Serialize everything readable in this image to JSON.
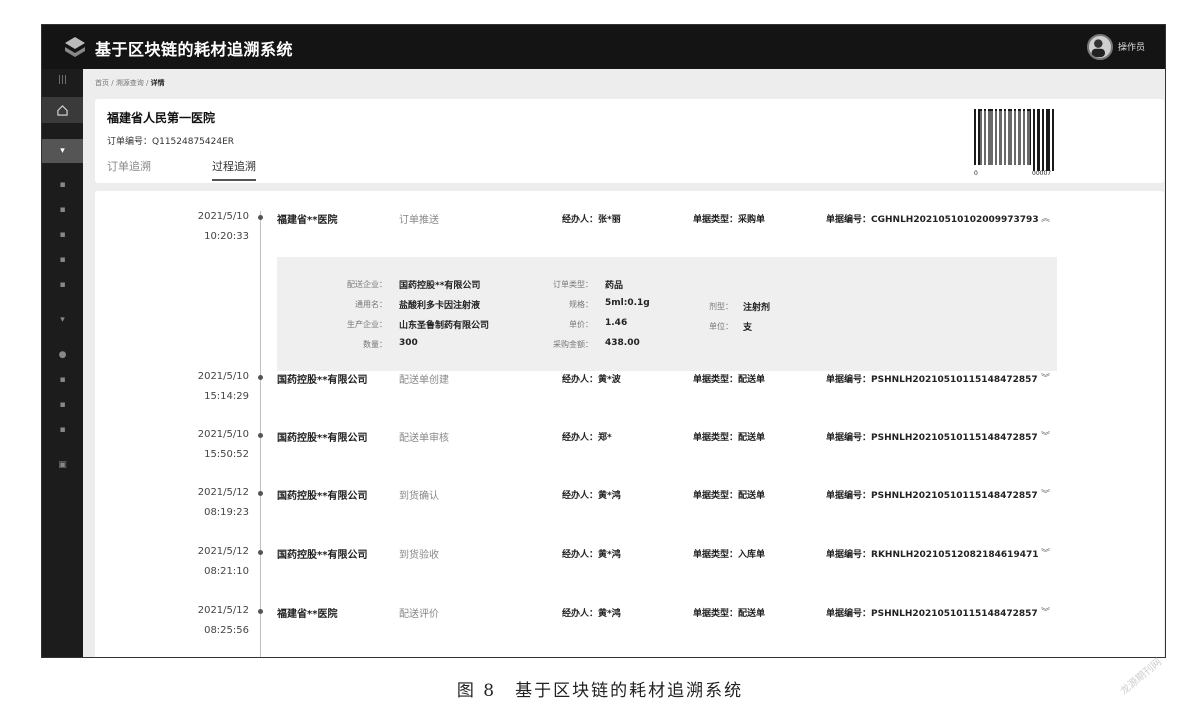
{
  "app": {
    "title": "基于区块链的耗材追溯系统",
    "user_name": "操作员"
  },
  "breadcrumb": {
    "home": "首页",
    "sep1": " / ",
    "query": "溯源查询",
    "sep2": " / ",
    "current": "详情"
  },
  "order": {
    "hospital": "福建省人民第一医院",
    "order_label": "订单编号：",
    "order_no": "Q11524875424ER",
    "barcode_left": "0",
    "barcode_right": "00007"
  },
  "tabs": [
    {
      "label": "订单追溯"
    },
    {
      "label": "过程追溯"
    }
  ],
  "labels": {
    "handler": "经办人：",
    "doc_type": "单据类型：",
    "doc_no": "单据编号："
  },
  "records": [
    {
      "date": "2021/5/10",
      "time": "10:20:33",
      "org": "福建省**医院",
      "action": "订单推送",
      "handler": "张*丽",
      "doc_type": "采购单",
      "doc_no": "CGHNLH20210510102009973793",
      "chev": "︽"
    },
    {
      "date": "2021/5/10",
      "time": "15:14:29",
      "org": "国药控股**有限公司",
      "action": "配送单创建",
      "handler": "黄*波",
      "doc_type": "配送单",
      "doc_no": "PSHNLH20210510115148472857",
      "chev": "︾"
    },
    {
      "date": "2021/5/10",
      "time": "15:50:52",
      "org": "国药控股**有限公司",
      "action": "配送单审核",
      "handler": "郑*",
      "doc_type": "配送单",
      "doc_no": "PSHNLH20210510115148472857",
      "chev": "︾"
    },
    {
      "date": "2021/5/12",
      "time": "08:19:23",
      "org": "国药控股**有限公司",
      "action": "到货确认",
      "handler": "黄*鸿",
      "doc_type": "配送单",
      "doc_no": "PSHNLH20210510115148472857",
      "chev": "︾"
    },
    {
      "date": "2021/5/12",
      "time": "08:21:10",
      "org": "国药控股**有限公司",
      "action": "到货验收",
      "handler": "黄*鸿",
      "doc_type": "入库单",
      "doc_no": "RKHNLH20210512082184619471",
      "chev": "︾"
    },
    {
      "date": "2021/5/12",
      "time": "08:25:56",
      "org": "福建省**医院",
      "action": "配送评价",
      "handler": "黄*鸿",
      "doc_type": "配送单",
      "doc_no": "PSHNLH20210510115148472857",
      "chev": "︾"
    }
  ],
  "detail": {
    "delivery_label": "配送企业：",
    "delivery": "国药控股**有限公司",
    "generic_label": "通用名：",
    "generic": "盐酸利多卡因注射液",
    "maker_label": "生产企业：",
    "maker": "山东圣鲁制药有限公司",
    "qty_label": "数量：",
    "qty": "300",
    "ordertype_label": "订单类型：",
    "ordertype": "药品",
    "spec_label": "规格：",
    "spec": "5ml:0.1g",
    "price_label": "单价：",
    "price": "1.46",
    "amount_label": "采购金额：",
    "amount": "438.00",
    "form_label": "剂型：",
    "form": "注射剂",
    "unit_label": "单位：",
    "unit": "支"
  },
  "figure_caption": "图 8　基于区块链的耗材追溯系统",
  "watermark": "龙源期刊网"
}
